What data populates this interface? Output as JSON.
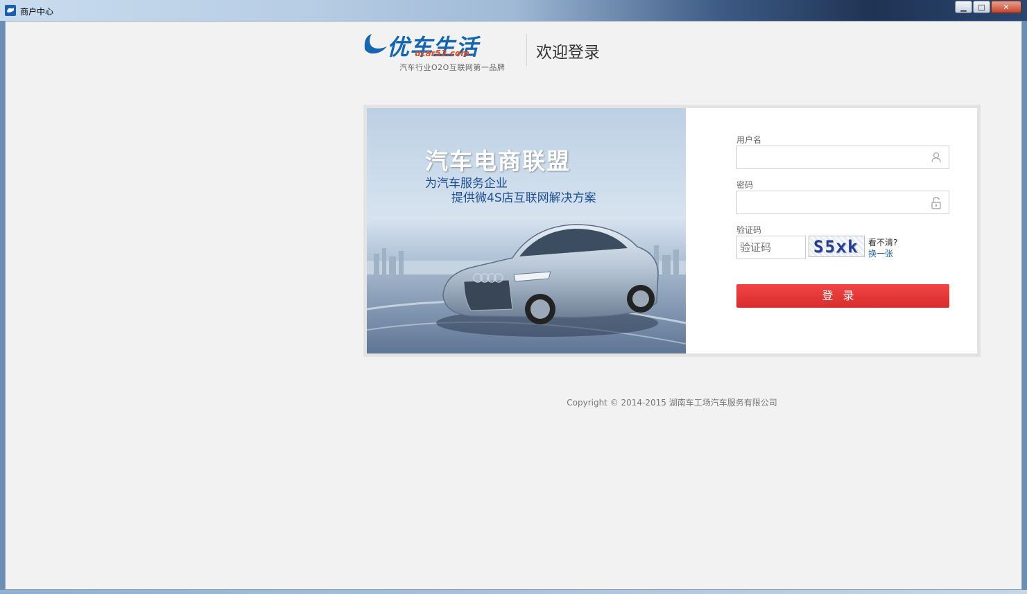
{
  "window": {
    "title": "商户中心",
    "minimize_label": "▁",
    "maximize_label": "□",
    "close_label": "✕"
  },
  "header": {
    "logo_text": "优车生活",
    "logo_domain": "ucar52.com",
    "logo_slogan": "汽车行业O2O互联网第一品牌",
    "welcome": "欢迎登录"
  },
  "banner": {
    "title": "汽车电商联盟",
    "line1": "为汽车服务企业",
    "line2": "提供微4S店互联网解决方案"
  },
  "form": {
    "username_label": "用户名",
    "username_value": "",
    "password_label": "密码",
    "password_value": "",
    "captcha_label": "验证码",
    "captcha_placeholder": "验证码",
    "captcha_image_text": "S5ⅹk",
    "unclear_text": "看不清?",
    "change_text": "换一张",
    "login_button": "登录"
  },
  "footer": {
    "copyright": "Copyright © 2014-2015 湖南车工场汽车服务有限公司"
  },
  "colors": {
    "accent_red": "#e53333",
    "brand_blue": "#1565b0"
  }
}
